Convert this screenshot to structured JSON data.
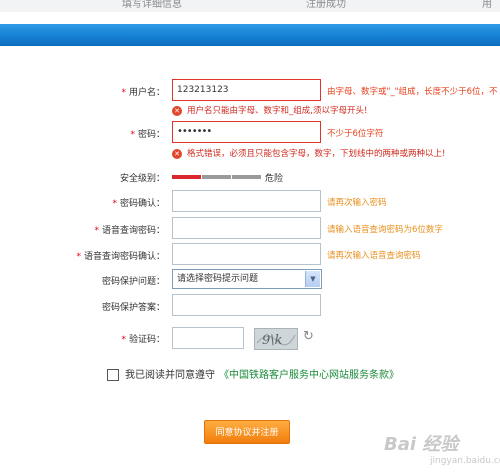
{
  "steps": [
    "填写详细信息",
    "注册成功",
    "用"
  ],
  "form": {
    "username": {
      "label": "用户名：",
      "value": "123213123",
      "hint": "由字母、数字或\"_\"组成，长度不少于6位，不",
      "error": "用户名只能由字母、数字和_组成,须以字母开头!"
    },
    "password": {
      "label": "密码：",
      "value": "•••••••",
      "hint": "不少于6位字符",
      "error": "格式错误，必须且只能包含字母，数字，下划线中的两种或两种以上!"
    },
    "strength": {
      "label": "安全级别：",
      "level_text": "危险",
      "colors": [
        "#d9272e",
        "#9a9a9a",
        "#9a9a9a"
      ]
    },
    "confirm": {
      "label": "密码确认：",
      "value": "",
      "hint": "请再次输入密码"
    },
    "voice_pwd": {
      "label": "语音查询密码：",
      "value": "",
      "hint": "请输入语音查询密码为6位数字"
    },
    "voice_confirm": {
      "label": "语音查询密码确认：",
      "value": "",
      "hint": "请再次输入语音查询密码"
    },
    "question": {
      "label": "密码保护问题：",
      "selected": "请选择密码提示问题"
    },
    "answer": {
      "label": "密码保护答案：",
      "value": ""
    },
    "captcha": {
      "label": "验证码：",
      "value": "",
      "image_text": "9\\k"
    },
    "agree": {
      "text": "我已阅读并同意遵守",
      "link": "《中国铁路客户服务中心网站服务条款》"
    },
    "submit": "同意协议并注册"
  },
  "required_mark": "*",
  "watermark": {
    "main": "Bai 经验",
    "sub": "jingyan.baidu.com"
  }
}
